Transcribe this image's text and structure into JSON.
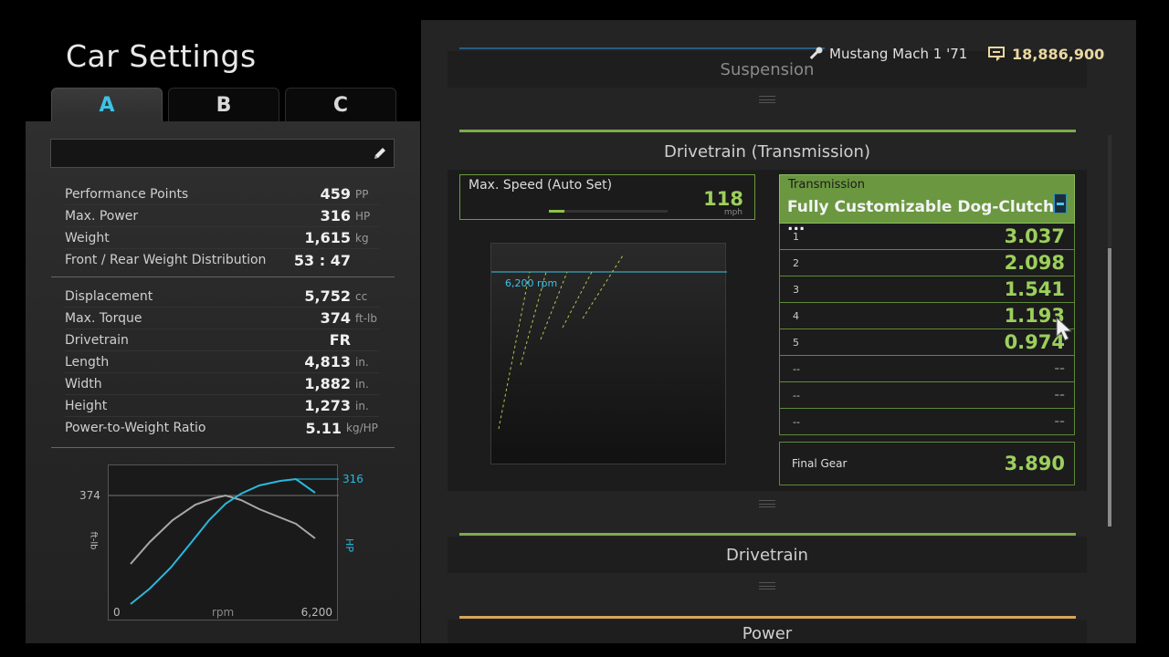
{
  "title": "Car Settings",
  "tabs": [
    {
      "label": "A",
      "active": true
    },
    {
      "label": "B",
      "active": false
    },
    {
      "label": "C",
      "active": false
    }
  ],
  "hud": {
    "car_name": "Mustang Mach 1 '71",
    "credits": "18,886,900"
  },
  "specs_group1": [
    {
      "label": "Performance Points",
      "value": "459",
      "unit": "PP"
    },
    {
      "label": "Max. Power",
      "value": "316",
      "unit": "HP"
    },
    {
      "label": "Weight",
      "value": "1,615",
      "unit": "kg"
    },
    {
      "label": "Front / Rear Weight Distribution",
      "value": "53 : 47",
      "unit": ""
    }
  ],
  "specs_group2": [
    {
      "label": "Displacement",
      "value": "5,752",
      "unit": "cc"
    },
    {
      "label": "Max. Torque",
      "value": "374",
      "unit": "ft-lb"
    },
    {
      "label": "Drivetrain",
      "value": "FR",
      "unit": ""
    },
    {
      "label": "Length",
      "value": "4,813",
      "unit": "in."
    },
    {
      "label": "Width",
      "value": "1,882",
      "unit": "in."
    },
    {
      "label": "Height",
      "value": "1,273",
      "unit": "in."
    },
    {
      "label": "Power-to-Weight Ratio",
      "value": "5.11",
      "unit": "kg/HP"
    }
  ],
  "power_graph": {
    "torque_max_label": "374",
    "power_max_label": "316",
    "x_min_label": "0",
    "x_max_label": "6,200",
    "x_axis_label": "rpm",
    "torque_axis_label": "ft-lb",
    "power_axis_label": "HP",
    "torque_color": "#a8a8a8",
    "power_color": "#29b8dc"
  },
  "sections": {
    "suspension": "Suspension",
    "drivetrain_transmission": "Drivetrain (Transmission)",
    "drivetrain": "Drivetrain",
    "power": "Power"
  },
  "max_speed": {
    "label": "Max. Speed (Auto Set)",
    "value": "118",
    "unit": "mph",
    "slider_fraction": 0.13
  },
  "ratio_graph": {
    "rpm_label": "6,200 rpm"
  },
  "transmission": {
    "label": "Transmission",
    "name": "Fully Customizable Dog-Clutch ...",
    "gears": [
      {
        "num": "1",
        "ratio": "3.037"
      },
      {
        "num": "2",
        "ratio": "2.098"
      },
      {
        "num": "3",
        "ratio": "1.541"
      },
      {
        "num": "4",
        "ratio": "1.193"
      },
      {
        "num": "5",
        "ratio": "0.974"
      },
      {
        "num": "--",
        "ratio": "--"
      },
      {
        "num": "--",
        "ratio": "--"
      },
      {
        "num": "--",
        "ratio": "--"
      }
    ],
    "final_gear_label": "Final Gear",
    "final_gear_value": "3.890"
  },
  "colors": {
    "accent_blue": "#3ec3e6",
    "accent_green": "#9ccf5c",
    "credits_gold": "#e9d7a2"
  },
  "icons": [
    "pencil-icon",
    "key-icon",
    "credits-icon",
    "transmission-icon",
    "mouse-cursor-icon"
  ]
}
